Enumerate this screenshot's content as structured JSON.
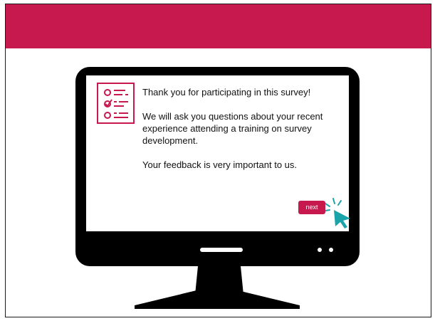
{
  "banner": {
    "color": "#c8194f"
  },
  "survey_icon": {
    "name": "checklist-icon",
    "color": "#c8194f"
  },
  "message": {
    "line1": "Thank you for participating in this survey!",
    "line2": "We will ask you questions about your recent experience attending a training on survey development.",
    "line3": "Your feedback is very important to us."
  },
  "next_button": {
    "label": "next",
    "color": "#c8194f"
  },
  "cursor": {
    "name": "click-cursor-icon",
    "color": "#1aa3a8"
  }
}
